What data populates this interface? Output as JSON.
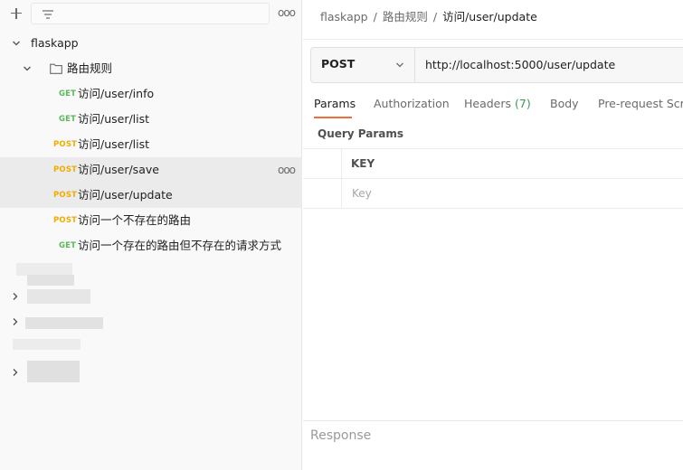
{
  "sidebar": {
    "toolbar": {
      "new_icon": "plus-icon",
      "filter_icon": "filter-icon",
      "menu_icon": "more-dots-icon",
      "filter_placeholder": ""
    },
    "collection": {
      "name": "flaskapp",
      "expanded": true
    },
    "folder": {
      "name": "路由规则",
      "expanded": true
    },
    "requests": [
      {
        "method": "GET",
        "label": "访问/user/info"
      },
      {
        "method": "GET",
        "label": "访问/user/list"
      },
      {
        "method": "POST",
        "label": "访问/user/list"
      },
      {
        "method": "POST",
        "label": "访问/user/save"
      },
      {
        "method": "POST",
        "label": "访问/user/update"
      },
      {
        "method": "POST",
        "label": "访问一个不存在的路由"
      },
      {
        "method": "GET",
        "label": "访问一个存在的路由但不存在的请求方式"
      }
    ],
    "more_dots": "ooo"
  },
  "main": {
    "breadcrumb": {
      "collection": "flaskapp",
      "folder": "路由规则",
      "request": "访问/user/update",
      "separator": "/"
    },
    "request": {
      "method": "POST",
      "url": "http://localhost:5000/user/update"
    },
    "tabs": {
      "params": "Params",
      "authorization": "Authorization",
      "headers": "Headers",
      "headers_count": "(7)",
      "body": "Body",
      "prerequest": "Pre-request Scri"
    },
    "query_params": {
      "title": "Query Params",
      "column_key": "KEY",
      "key_placeholder": "Key"
    },
    "response": {
      "label": "Response"
    }
  },
  "colors": {
    "get": "#5cb85c",
    "post": "#f0ad00",
    "accent": "#f26b3a",
    "sidebar_bg": "#f9f9f9",
    "active_row": "#ebebeb"
  }
}
